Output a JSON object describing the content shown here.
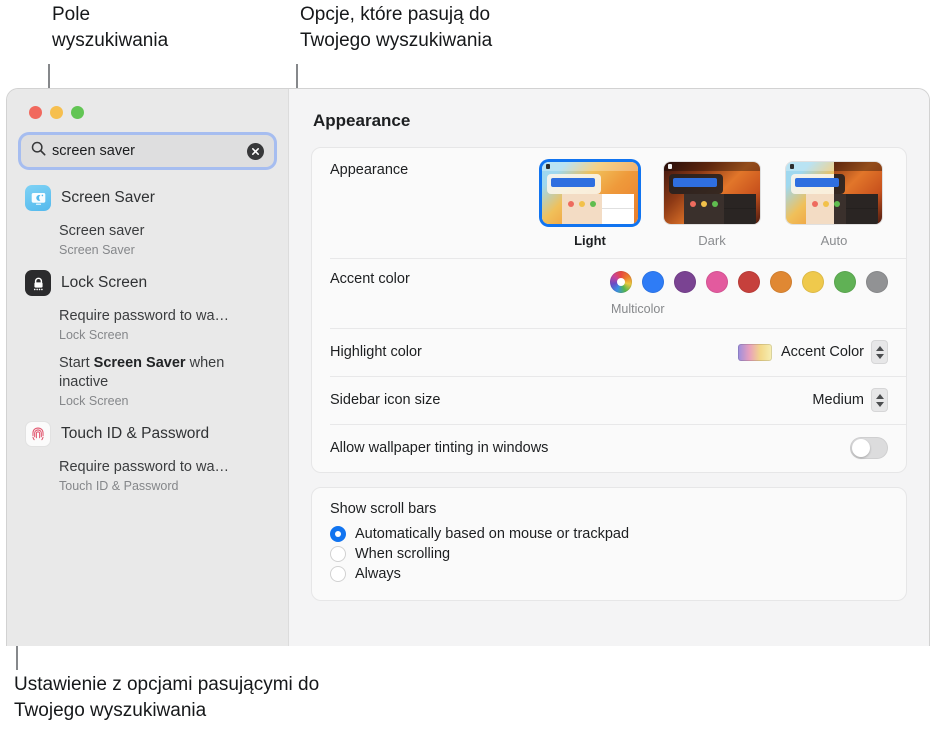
{
  "annotations": {
    "search_field": "Pole\nwyszukiwania",
    "matching_options": "Opcje, które pasują do\nTwojego wyszukiwania",
    "setting_with_options": "Ustawienie z opcjami pasującymi do\nTwojego wyszukiwania"
  },
  "window": {
    "traffic_lights": [
      "close",
      "minimize",
      "zoom"
    ]
  },
  "search": {
    "value": "screen saver",
    "icon": "search-icon",
    "clear_icon": "clear-icon"
  },
  "results": [
    {
      "app": "Screen Saver",
      "icon": "screen-saver-icon",
      "items": [
        {
          "title": "Screen saver",
          "title_bold": "",
          "subtitle": "Screen Saver"
        }
      ]
    },
    {
      "app": "Lock Screen",
      "icon": "lock-screen-icon",
      "items": [
        {
          "title": "Require password to wa…",
          "title_bold": "",
          "subtitle": "Lock Screen"
        },
        {
          "title_prefix": "Start ",
          "title_bold": "Screen Saver",
          "title_suffix": " when inactive",
          "subtitle": "Lock Screen"
        }
      ]
    },
    {
      "app": "Touch ID & Password",
      "icon": "touch-id-icon",
      "items": [
        {
          "title": "Require password to wa…",
          "title_bold": "",
          "subtitle": "Touch ID & Password"
        }
      ]
    }
  ],
  "detail": {
    "title": "Appearance",
    "appearance_row": {
      "label": "Appearance",
      "options": [
        {
          "label": "Light",
          "selected": true
        },
        {
          "label": "Dark",
          "selected": false
        },
        {
          "label": "Auto",
          "selected": false
        }
      ]
    },
    "accent_row": {
      "label": "Accent color",
      "selected_label": "Multicolor",
      "swatches": [
        {
          "name": "Multicolor",
          "color": "multicolor"
        },
        {
          "name": "Blue",
          "color": "#2e7cf6"
        },
        {
          "name": "Purple",
          "color": "#7a4392"
        },
        {
          "name": "Pink",
          "color": "#e35a9e"
        },
        {
          "name": "Red",
          "color": "#c6403c"
        },
        {
          "name": "Orange",
          "color": "#e08833"
        },
        {
          "name": "Yellow",
          "color": "#efc94c"
        },
        {
          "name": "Green",
          "color": "#60b155"
        },
        {
          "name": "Graphite",
          "color": "#919294"
        }
      ]
    },
    "highlight_row": {
      "label": "Highlight color",
      "value": "Accent Color"
    },
    "sidebar_icon_row": {
      "label": "Sidebar icon size",
      "value": "Medium"
    },
    "tinting_row": {
      "label": "Allow wallpaper tinting in windows",
      "enabled": false
    },
    "scroll_bars": {
      "heading": "Show scroll bars",
      "options": [
        {
          "label": "Automatically based on mouse or trackpad",
          "selected": true
        },
        {
          "label": "When scrolling",
          "selected": false
        },
        {
          "label": "Always",
          "selected": false
        }
      ]
    }
  }
}
